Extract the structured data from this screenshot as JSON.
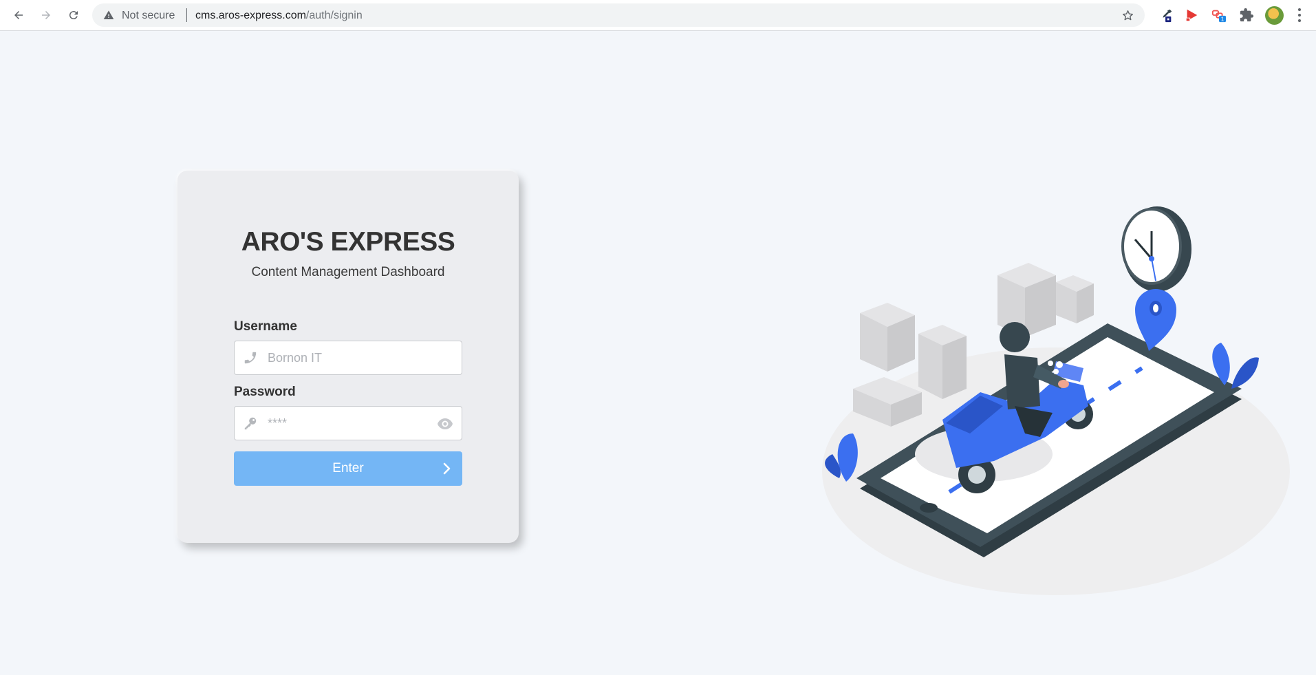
{
  "browser": {
    "security_label": "Not secure",
    "url_host": "cms.aros-express.com",
    "url_path": "/auth/signin",
    "extension_badge": "1"
  },
  "login": {
    "title": "ARO'S EXPRESS",
    "subtitle": "Content Management Dashboard",
    "username_label": "Username",
    "username_placeholder": "Bornon IT",
    "password_label": "Password",
    "password_placeholder": "****",
    "submit_label": "Enter"
  },
  "colors": {
    "primary_button": "#74b6f5",
    "illustration_blue": "#3b6ff0",
    "phone_dark": "#37474f",
    "page_background": "#f3f6fa"
  }
}
